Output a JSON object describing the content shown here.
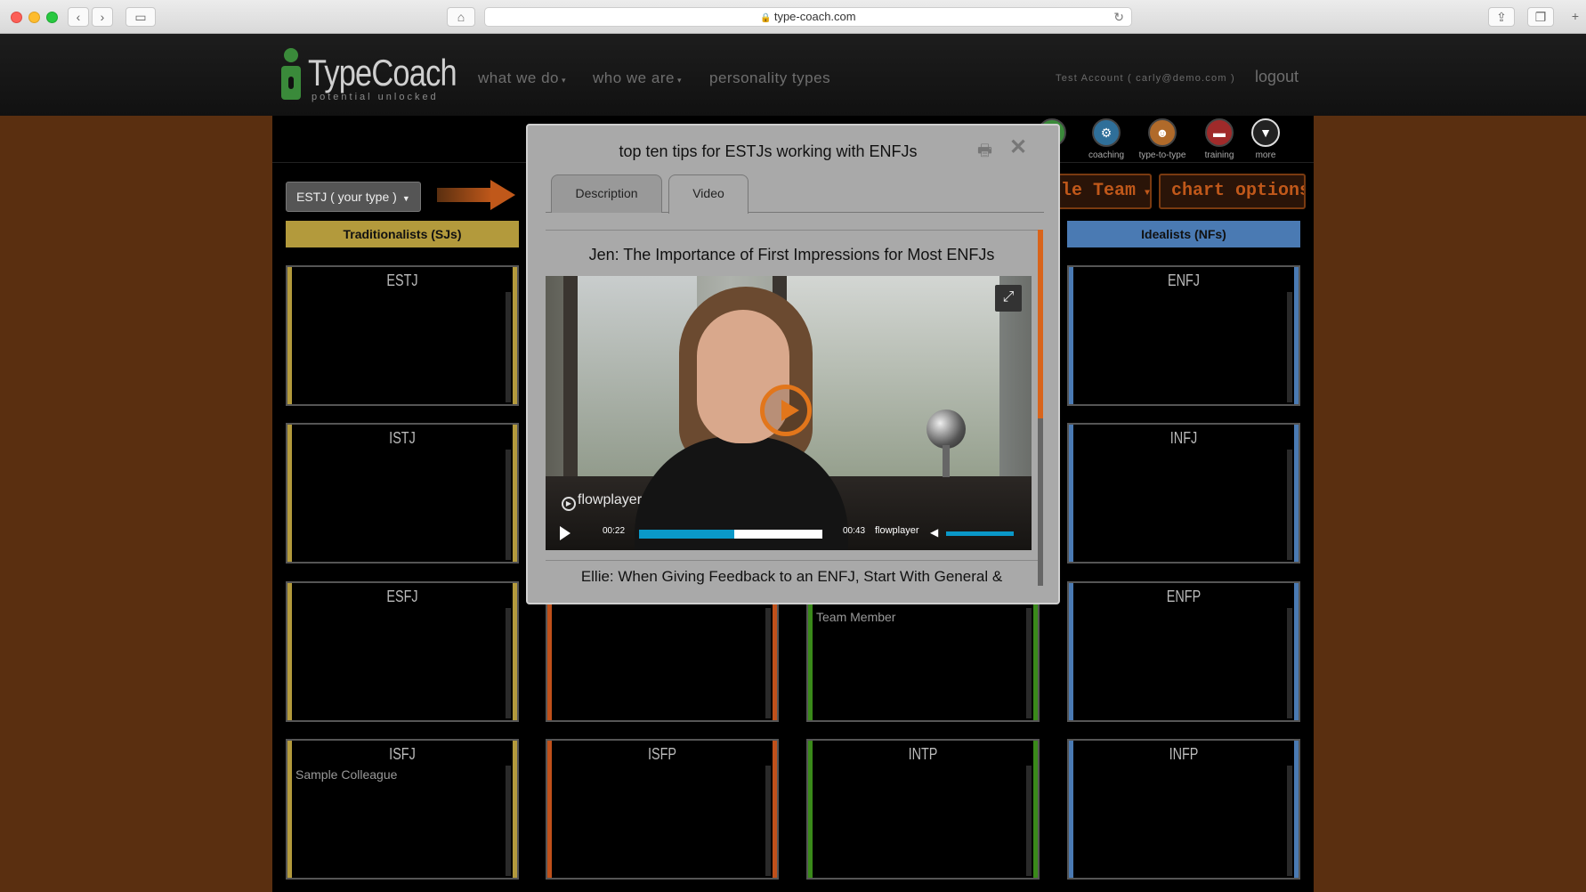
{
  "browser": {
    "url": "type-coach.com"
  },
  "header": {
    "logo_name": "TypeCoach",
    "logo_tagline": "potential unlocked",
    "nav": [
      "what we do",
      "who we are",
      "personality types"
    ],
    "account": "Test Account ( carly@demo.com )",
    "logout": "logout"
  },
  "toolbar": {
    "icons": [
      {
        "label": "+",
        "icon": "add-icon",
        "color": "#3a8a3a"
      },
      {
        "label": "coaching",
        "icon": "coaching-icon",
        "color": "#2f6f99"
      },
      {
        "label": "type-to-type",
        "icon": "type-to-type-icon",
        "color": "#b06a2a"
      },
      {
        "label": "training",
        "icon": "training-icon",
        "color": "#a02a2a"
      },
      {
        "label": "more",
        "icon": "chevron-down-icon",
        "color": "#444"
      }
    ],
    "type_select": "ESTJ ( your type )",
    "team_button": "ple Team",
    "chart_options": "chart options"
  },
  "columns": {
    "sj": {
      "label": "Traditionalists (SJs)",
      "color": "#b39a3c"
    },
    "nf": {
      "label": "Idealists (NFs)",
      "color": "#4a7ab3"
    }
  },
  "cards": {
    "estj": "ESTJ",
    "istj": "ISTJ",
    "esfj": "ESFJ",
    "isfj": "ISFJ",
    "isfp": "ISFP",
    "intp": "INTP",
    "enfj": "ENFJ",
    "infj": "INFJ",
    "enfp": "ENFP",
    "infp": "INFP",
    "team_member": "Team Member",
    "sample_colleague": "Sample Colleague"
  },
  "modal": {
    "title": "top ten tips for ESTJs working with ENFJs",
    "tabs": [
      "Description",
      "Video"
    ],
    "active_tab": "Video",
    "video_title": "Jen: The Importance of First Impressions for Most ENFJs",
    "player": {
      "brand_overlay": "flowplayer",
      "elapsed": "00:22",
      "duration": "00:43",
      "progress": 0.52,
      "brand": "flowplayer",
      "accent": "#0a98c8",
      "play_color": "#e2761b"
    },
    "next_title": "Ellie: When Giving Feedback to an ENFJ, Start With General &"
  }
}
